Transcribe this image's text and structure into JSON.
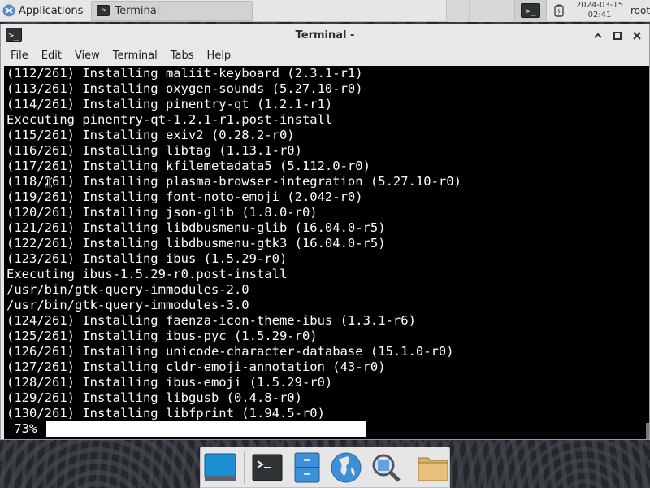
{
  "panel": {
    "applications_label": "Applications",
    "task_label": "Terminal -",
    "clock_date": "2024-03-15",
    "clock_time": "02:41",
    "user": "root"
  },
  "window": {
    "title": "Terminal -",
    "menu": [
      "File",
      "Edit",
      "View",
      "Terminal",
      "Tabs",
      "Help"
    ]
  },
  "terminal": {
    "lines": [
      "(112/261) Installing maliit-keyboard (2.3.1-r1)",
      "(113/261) Installing oxygen-sounds (5.27.10-r0)",
      "(114/261) Installing pinentry-qt (1.2.1-r1)",
      "Executing pinentry-qt-1.2.1-r1.post-install",
      "(115/261) Installing exiv2 (0.28.2-r0)",
      "(116/261) Installing libtag (1.13.1-r0)",
      "(117/261) Installing kfilemetadata5 (5.112.0-r0)",
      "(118/261) Installing plasma-browser-integration (5.27.10-r0)",
      "(119/261) Installing font-noto-emoji (2.042-r0)",
      "(120/261) Installing json-glib (1.8.0-r0)",
      "(121/261) Installing libdbusmenu-glib (16.04.0-r5)",
      "(122/261) Installing libdbusmenu-gtk3 (16.04.0-r5)",
      "(123/261) Installing ibus (1.5.29-r0)",
      "Executing ibus-1.5.29-r0.post-install",
      "/usr/bin/gtk-query-immodules-2.0",
      "/usr/bin/gtk-query-immodules-3.0",
      "(124/261) Installing faenza-icon-theme-ibus (1.3.1-r6)",
      "(125/261) Installing ibus-pyc (1.5.29-r0)",
      "(126/261) Installing unicode-character-database (15.1.0-r0)",
      "(127/261) Installing cldr-emoji-annotation (43-r0)",
      "(128/261) Installing ibus-emoji (1.5.29-r0)",
      "(129/261) Installing libgusb (0.4.8-r0)",
      "(130/261) Installing libfprint (1.94.5-r0)"
    ],
    "progress_label": " 73%",
    "progress_fraction": 0.73
  },
  "dock": {
    "items": [
      "show-desktop-icon",
      "terminal-icon",
      "file-manager-icon",
      "web-browser-icon",
      "app-finder-icon",
      "folder-icon"
    ]
  },
  "colors": {
    "terminal_bg": "#000000",
    "terminal_fg": "#ffffff",
    "panel_bg": "#e6e6e6"
  }
}
